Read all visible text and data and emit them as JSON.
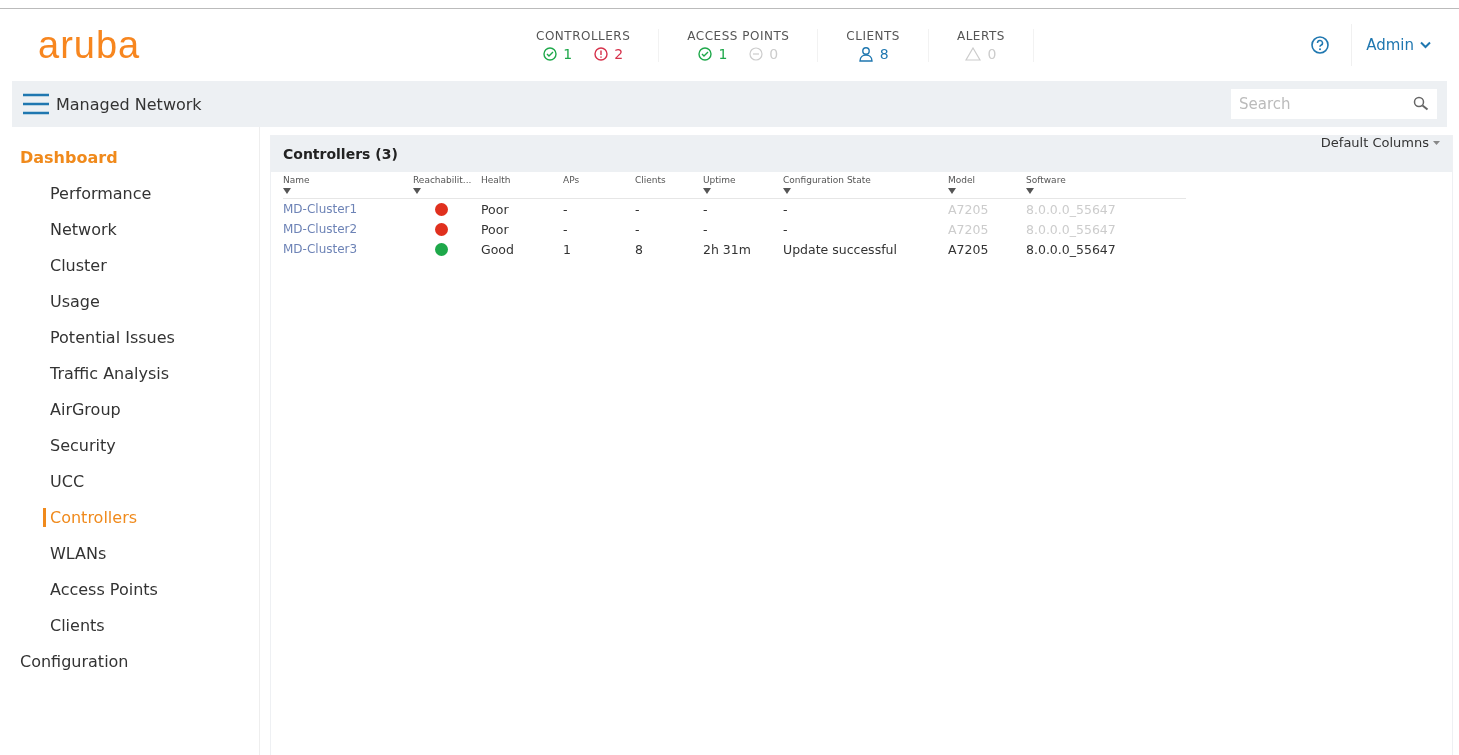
{
  "logo": "aruba",
  "stats": [
    {
      "title": "CONTROLLERS",
      "items": [
        {
          "kind": "ok",
          "count": "1",
          "dim": false
        },
        {
          "kind": "critical",
          "count": "2",
          "dim": false
        }
      ]
    },
    {
      "title": "ACCESS POINTS",
      "items": [
        {
          "kind": "ok",
          "count": "1",
          "dim": false
        },
        {
          "kind": "down",
          "count": "0",
          "dim": true
        }
      ]
    },
    {
      "title": "CLIENTS",
      "items": [
        {
          "kind": "clients",
          "count": "8",
          "dim": false
        }
      ]
    },
    {
      "title": "ALERTS",
      "items": [
        {
          "kind": "alert",
          "count": "0",
          "dim": true
        }
      ]
    }
  ],
  "user": "Admin",
  "nav_title": "Managed Network",
  "search": {
    "placeholder": "Search"
  },
  "sidebar": {
    "items": [
      {
        "label": "Dashboard",
        "selected": false,
        "children": [
          {
            "label": "Performance",
            "selected": false
          },
          {
            "label": "Network",
            "selected": false
          },
          {
            "label": "Cluster",
            "selected": false
          },
          {
            "label": "Usage",
            "selected": false
          },
          {
            "label": "Potential Issues",
            "selected": false
          },
          {
            "label": "Traffic Analysis",
            "selected": false
          },
          {
            "label": "AirGroup",
            "selected": false
          },
          {
            "label": "Security",
            "selected": false
          },
          {
            "label": "UCC",
            "selected": false
          },
          {
            "label": "Controllers",
            "selected": true
          },
          {
            "label": "WLANs",
            "selected": false
          },
          {
            "label": "Access Points",
            "selected": false
          },
          {
            "label": "Clients",
            "selected": false
          }
        ],
        "expanded": true
      },
      {
        "label": "Configuration",
        "selected": false,
        "expanded": false
      }
    ]
  },
  "column_menu": "Default Columns",
  "table": {
    "title": "Controllers (3)",
    "columns": [
      {
        "label": "Name",
        "filter": true
      },
      {
        "label": "Reachabilit...",
        "filter": true
      },
      {
        "label": "Health",
        "filter": false
      },
      {
        "label": "APs",
        "filter": false
      },
      {
        "label": "Clients",
        "filter": false
      },
      {
        "label": "Uptime",
        "filter": true
      },
      {
        "label": "Configuration State",
        "filter": true
      },
      {
        "label": "Model",
        "filter": true
      },
      {
        "label": "Software",
        "filter": true
      }
    ],
    "rows": [
      {
        "name": "MD-Cluster1",
        "color": "#e0301e",
        "health": "Poor",
        "aps": "-",
        "clients": "-",
        "uptime": "-",
        "config": "-",
        "model": "A7205",
        "software": "8.0.0.0_55647",
        "dim": true
      },
      {
        "name": "MD-Cluster2",
        "color": "#e0301e",
        "health": "Poor",
        "aps": "-",
        "clients": "-",
        "uptime": "-",
        "config": "-",
        "model": "A7205",
        "software": "8.0.0.0_55647",
        "dim": true
      },
      {
        "name": "MD-Cluster3",
        "color": "#1ea84a",
        "health": "Good",
        "aps": "1",
        "clients": "8",
        "uptime": "2h 31m",
        "config": "Update successful",
        "model": "A7205",
        "software": "8.0.0.0_55647",
        "dim": false
      }
    ]
  }
}
